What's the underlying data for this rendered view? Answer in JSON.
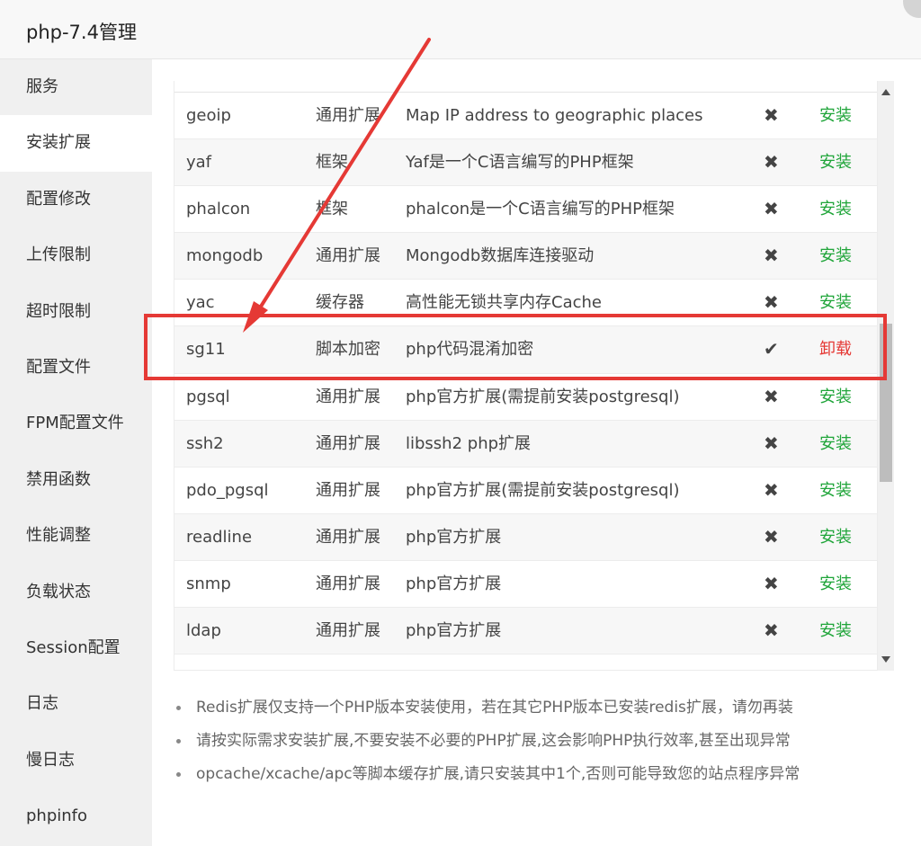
{
  "window": {
    "title": "php-7.4管理"
  },
  "sidebar": {
    "items": [
      {
        "label": "服务",
        "active": false
      },
      {
        "label": "安装扩展",
        "active": true
      },
      {
        "label": "配置修改",
        "active": false
      },
      {
        "label": "上传限制",
        "active": false
      },
      {
        "label": "超时限制",
        "active": false
      },
      {
        "label": "配置文件",
        "active": false
      },
      {
        "label": "FPM配置文件",
        "active": false
      },
      {
        "label": "禁用函数",
        "active": false
      },
      {
        "label": "性能调整",
        "active": false
      },
      {
        "label": "负载状态",
        "active": false
      },
      {
        "label": "Session配置",
        "active": false
      },
      {
        "label": "日志",
        "active": false
      },
      {
        "label": "慢日志",
        "active": false
      },
      {
        "label": "phpinfo",
        "active": false
      }
    ]
  },
  "extensions": [
    {
      "name": "geoip",
      "type": "通用扩展",
      "desc": "Map IP address to geographic places",
      "installed": false,
      "action": "安装"
    },
    {
      "name": "yaf",
      "type": "框架",
      "desc": "Yaf是一个C语言编写的PHP框架",
      "installed": false,
      "action": "安装"
    },
    {
      "name": "phalcon",
      "type": "框架",
      "desc": "phalcon是一个C语言编写的PHP框架",
      "installed": false,
      "action": "安装"
    },
    {
      "name": "mongodb",
      "type": "通用扩展",
      "desc": "Mongodb数据库连接驱动",
      "installed": false,
      "action": "安装"
    },
    {
      "name": "yac",
      "type": "缓存器",
      "desc": "高性能无锁共享内存Cache",
      "installed": false,
      "action": "安装"
    },
    {
      "name": "sg11",
      "type": "脚本加密",
      "desc": "php代码混淆加密",
      "installed": true,
      "action": "卸载"
    },
    {
      "name": "pgsql",
      "type": "通用扩展",
      "desc": "php官方扩展(需提前安装postgresql)",
      "installed": false,
      "action": "安装"
    },
    {
      "name": "ssh2",
      "type": "通用扩展",
      "desc": "libssh2 php扩展",
      "installed": false,
      "action": "安装"
    },
    {
      "name": "pdo_pgsql",
      "type": "通用扩展",
      "desc": "php官方扩展(需提前安装postgresql)",
      "installed": false,
      "action": "安装"
    },
    {
      "name": "readline",
      "type": "通用扩展",
      "desc": "php官方扩展",
      "installed": false,
      "action": "安装"
    },
    {
      "name": "snmp",
      "type": "通用扩展",
      "desc": "php官方扩展",
      "installed": false,
      "action": "安装"
    },
    {
      "name": "ldap",
      "type": "通用扩展",
      "desc": "php官方扩展",
      "installed": false,
      "action": "安装"
    }
  ],
  "tips": [
    "Redis扩展仅支持一个PHP版本安装使用，若在其它PHP版本已安装redis扩展，请勿再装",
    "请按实际需求安装扩展,不要安装不必要的PHP扩展,这会影响PHP执行效率,甚至出现异常",
    "opcache/xcache/apc等脚本缓存扩展,请只安装其中1个,否则可能导致您的站点程序异常"
  ],
  "icons": {
    "installed": "check-icon",
    "not_installed": "cross-icon"
  },
  "colors": {
    "install": "#20a53a",
    "uninstall": "#e53935",
    "annotation": "#e53935"
  }
}
